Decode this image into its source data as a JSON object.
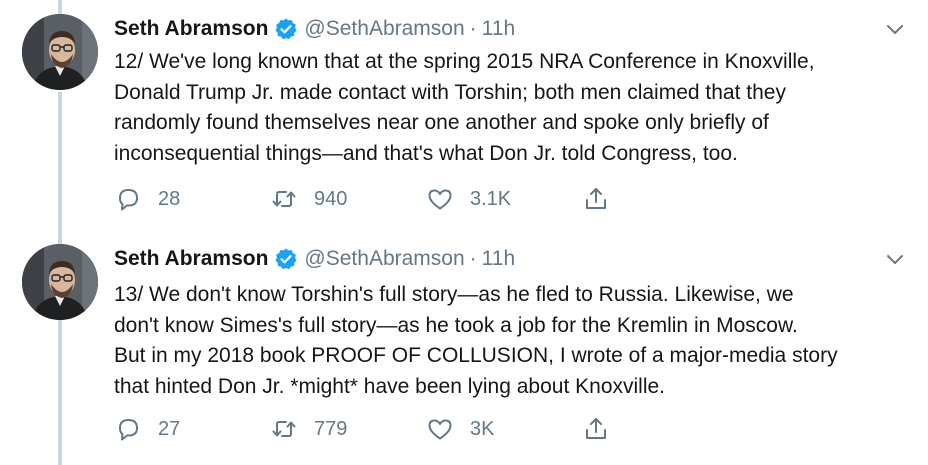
{
  "tweets": [
    {
      "author_name": "Seth Abramson",
      "handle": "@SethAbramson",
      "separator": "·",
      "time": "11h",
      "lines": [
        "12/ We've long known that at the spring 2015 NRA Conference in Knoxville,",
        "Donald Trump Jr. made contact with Torshin; both men claimed that they",
        "randomly found themselves near one another and spoke only briefly of",
        "inconsequential things—and that's what Don Jr. told Congress, too."
      ],
      "replies": "28",
      "retweets": "940",
      "likes": "3.1K"
    },
    {
      "author_name": "Seth Abramson",
      "handle": "@SethAbramson",
      "separator": "·",
      "time": "11h",
      "lines": [
        "13/ We don't know Torshin's full story—as he fled to Russia. Likewise, we",
        "don't know Simes's full story—as he took a job for the Kremlin in Moscow.",
        "But in my 2018 book PROOF OF COLLUSION, I wrote of a major-media story",
        "that hinted Don Jr. *might* have been lying about Knoxville."
      ],
      "replies": "27",
      "retweets": "779",
      "likes": "3K"
    }
  ],
  "icons": {
    "verified": "verified-badge-icon",
    "caret": "chevron-down-icon",
    "reply": "reply-icon",
    "retweet": "retweet-icon",
    "like": "heart-icon",
    "share": "share-icon"
  },
  "colors": {
    "text": "#14171a",
    "secondary": "#657786",
    "verified": "#1da1f2",
    "thread_line": "#ccd6dd"
  }
}
